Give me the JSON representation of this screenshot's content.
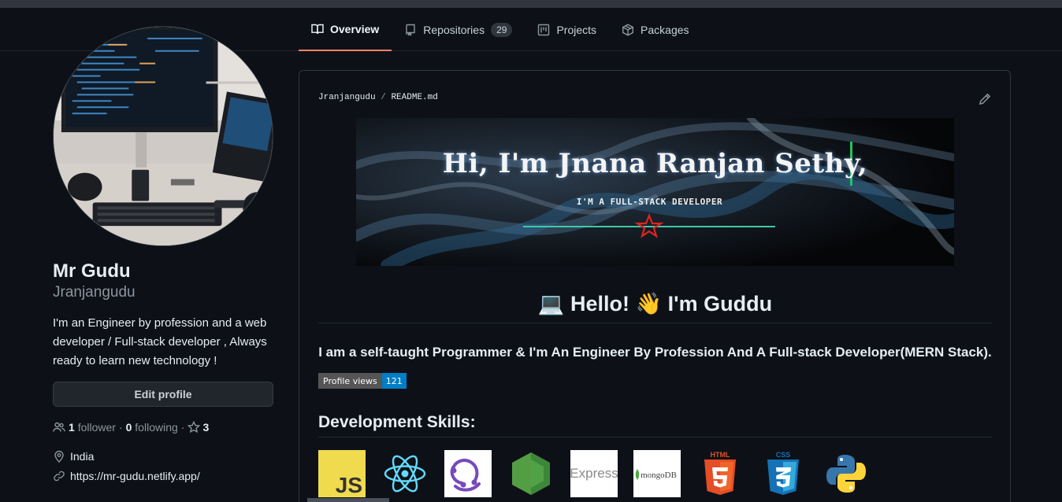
{
  "nav": {
    "tabs": [
      {
        "label": "Overview",
        "icon": "book-icon"
      },
      {
        "label": "Repositories",
        "icon": "repo-icon",
        "count": "29"
      },
      {
        "label": "Projects",
        "icon": "project-icon"
      },
      {
        "label": "Packages",
        "icon": "package-icon"
      }
    ]
  },
  "profile": {
    "name": "Mr Gudu",
    "login": "Jranjangudu",
    "bio": "I'm an Engineer by profession and a web developer / Full-stack developer , Always ready to learn new technology !",
    "status_emoji": "💻",
    "edit_label": "Edit profile",
    "followers_count": "1",
    "followers_label": "follower",
    "separator": "·",
    "following_count": "0",
    "following_label": "following",
    "stars_count": "3",
    "location": "India",
    "website": "https://mr-gudu.netlify.app/"
  },
  "readme": {
    "owner": "Jranjangudu",
    "slash": "/",
    "file": "README.md",
    "banner_title": "Hi, I'm Jnana Ranjan Sethy,",
    "banner_subtitle": "I'M A FULL-STACK DEVELOPER",
    "heading": "💻 Hello! 👋 I'm Guddu",
    "lead": "I am a self-taught Programmer & I'm An Engineer By Profession And A Full-stack Developer(MERN Stack).",
    "badge_label": "Profile views",
    "badge_value": "121",
    "skills_heading": "Development Skills:",
    "skills": [
      {
        "name": "javascript-icon",
        "text": "JS"
      },
      {
        "name": "react-icon"
      },
      {
        "name": "redux-icon"
      },
      {
        "name": "nodejs-icon"
      },
      {
        "name": "express-icon",
        "text": "Express"
      },
      {
        "name": "mongodb-icon",
        "text": "mongoDB"
      },
      {
        "name": "html5-icon",
        "text": "HTML"
      },
      {
        "name": "css3-icon",
        "text": "CSS"
      },
      {
        "name": "python-icon"
      }
    ]
  },
  "colors": {
    "background": "#0d1117",
    "accent_tab": "#f78166",
    "badge_value_bg": "#007ec6"
  }
}
